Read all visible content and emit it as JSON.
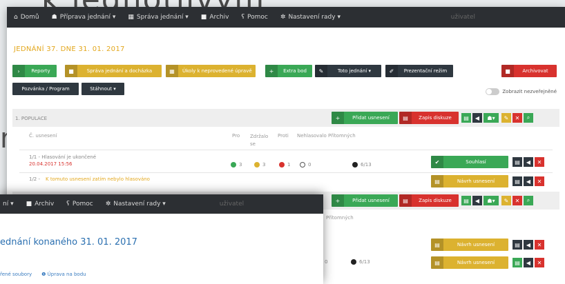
{
  "background": {
    "heading_fragment": "k jednotlivým",
    "left_letter": "n"
  },
  "navbar": {
    "items": [
      {
        "icon": "home-icon",
        "glyph": "⌂",
        "label": "Domů"
      },
      {
        "icon": "users-icon",
        "glyph": "☗",
        "label": "Příprava jednání ▾"
      },
      {
        "icon": "grid-icon",
        "glyph": "▦",
        "label": "Správa jednání ▾"
      },
      {
        "icon": "archive-icon",
        "glyph": "■",
        "label": "Archiv"
      },
      {
        "icon": "help-icon",
        "glyph": "ʕ",
        "label": "Pomoc"
      },
      {
        "icon": "settings-icon",
        "glyph": "✲",
        "label": "Nastavení rady ▾"
      }
    ],
    "user": "uživatel"
  },
  "page_title": "JEDNÁNÍ 37. DNE 31. 01. 2017",
  "toolbar": {
    "reports": "Reporty",
    "attendance": "Správa jednání a docházka",
    "unvoted": "Úkoly k neprovedené úpravě",
    "extra": "Extra bod",
    "this_meeting": "Toto jednání ▾",
    "presentation": "Prezentační režim",
    "archive": "Archivovat",
    "invite": "Pozvánka / Program",
    "download": "Stáhnout ▾"
  },
  "toggle_label": "Zobrazit nezveřejněné",
  "section": {
    "title": "1. POPULACE",
    "add_resolution": "Přidat usnesení",
    "open_discussion": "Zapis diskuze"
  },
  "columns": {
    "resolution": "Č. usnesení",
    "for": "Pro",
    "abstain": "Zdržalo se",
    "against": "Proti",
    "not_voted": "Nehlasovalo",
    "present": "Přítomných"
  },
  "rows": [
    {
      "text": "1/1 - Hlasování je ukončené",
      "date": "20.04.2017 15:56",
      "votes": {
        "for": "3",
        "abstain": "3",
        "against": "1",
        "not_voted": "0",
        "present": "6/13"
      },
      "action": "Souhlasí"
    },
    {
      "text": "1/2 -",
      "note": "K tomuto usnesení zatím nebylo hlasováno",
      "action": "Návrh usnesení"
    }
  ],
  "row3_present": "6/13",
  "row3_num": "0",
  "row3_action": "Návrh usnesení",
  "popup": {
    "nav_items": [
      {
        "label": "ní ▾"
      },
      {
        "icon": "archive-icon",
        "glyph": "■",
        "label": "Archiv"
      },
      {
        "icon": "help-icon",
        "glyph": "ʕ",
        "label": "Pomoc"
      },
      {
        "icon": "settings-icon",
        "glyph": "✲",
        "label": "Nastavení rady ▾"
      }
    ],
    "user": "uživatel",
    "title": "ednání konaného 31. 01. 2017",
    "link1": "řené soubory",
    "link2": "Úprava na bodu"
  },
  "colors": {
    "green": "#3aa856",
    "yellow": "#dcb230",
    "red": "#d8322e",
    "dark": "#2f3840",
    "title": "#e3a71c"
  }
}
